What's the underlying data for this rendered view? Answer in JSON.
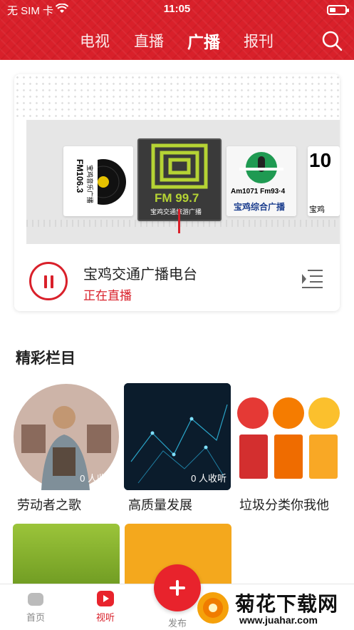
{
  "status_bar": {
    "carrier": "无 SIM 卡",
    "time": "11:05"
  },
  "nav": {
    "tabs": [
      "电视",
      "直播",
      "广播",
      "报刊"
    ],
    "active_tab": "广播"
  },
  "player": {
    "station_name": "宝鸡交通广播电台",
    "status": "正在直播",
    "stations": [
      {
        "logo_text": "FM106.3",
        "logo_sub": "宝鸡音乐广播"
      },
      {
        "logo_text": "FM 99.7",
        "logo_sub": "宝鸡交通旅游广播"
      },
      {
        "logo_text": "Am1071 Fm93·4",
        "logo_sub": "宝鸡综合广播"
      },
      {
        "logo_text": "10",
        "logo_sub": "宝鸡"
      }
    ]
  },
  "section": {
    "title": "精彩栏目"
  },
  "programs": [
    {
      "title": "劳动者之歌",
      "count": "0 人收听"
    },
    {
      "title": "高质量发展",
      "count": "0 人收听"
    },
    {
      "title": "垃圾分类你我他",
      "count": ""
    }
  ],
  "bottom_nav": {
    "home": "首页",
    "listen": "视听",
    "publish": "发布"
  },
  "watermark": {
    "title": "菊花下载网",
    "url": "www.juahar.com"
  },
  "colors": {
    "brand_red": "#d9202a",
    "fab_red": "#e8232c"
  }
}
